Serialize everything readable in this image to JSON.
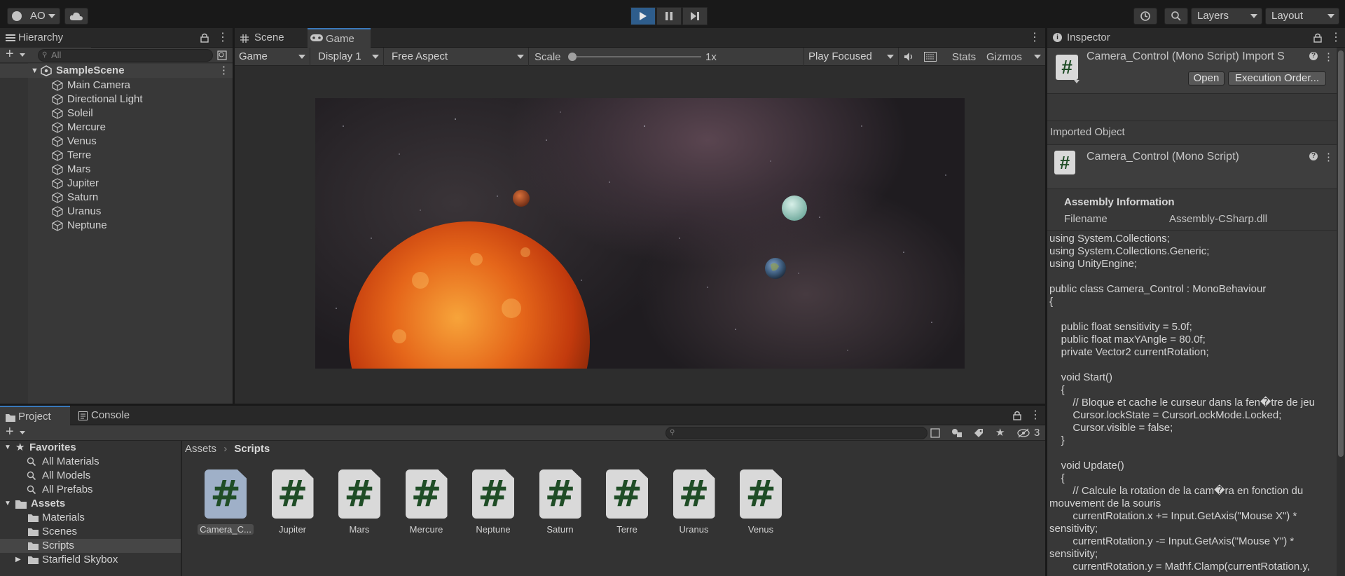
{
  "toolbar": {
    "account": "AO",
    "layers": "Layers",
    "layout": "Layout"
  },
  "hierarchy": {
    "tab": "Hierarchy",
    "search_placeholder": "All",
    "scene": "SampleScene",
    "items": [
      "Main Camera",
      "Directional Light",
      "Soleil",
      "Mercure",
      "Venus",
      "Terre",
      "Mars",
      "Jupiter",
      "Saturn",
      "Uranus",
      "Neptune"
    ]
  },
  "game_view": {
    "tabs": [
      "Scene",
      "Game"
    ],
    "mode": "Game",
    "display": "Display 1",
    "aspect": "Free Aspect",
    "scale_label": "Scale",
    "scale_value": "1x",
    "play_mode": "Play Focused",
    "stats": "Stats",
    "gizmos": "Gizmos"
  },
  "inspector": {
    "tab": "Inspector",
    "title": "Camera_Control (Mono Script) Import S",
    "open_button": "Open",
    "exec_button": "Execution Order...",
    "imported_object": "Imported Object",
    "object_title": "Camera_Control (Mono Script)",
    "assembly_header": "Assembly Information",
    "filename_label": "Filename",
    "filename_value": "Assembly-CSharp.dll",
    "code": "using System.Collections;\nusing System.Collections.Generic;\nusing UnityEngine;\n\npublic class Camera_Control : MonoBehaviour\n{\n\n    public float sensitivity = 5.0f;\n    public float maxYAngle = 80.0f;\n    private Vector2 currentRotation;\n\n    void Start()\n    {\n        // Bloque et cache le curseur dans la fen�tre de jeu\n        Cursor.lockState = CursorLockMode.Locked;\n        Cursor.visible = false;\n    }\n\n    void Update()\n    {\n        // Calcule la rotation de la cam�ra en fonction du mouvement de la souris\n        currentRotation.x += Input.GetAxis(\"Mouse X\") * sensitivity;\n        currentRotation.y -= Input.GetAxis(\"Mouse Y\") * sensitivity;\n        currentRotation.y = Mathf.Clamp(currentRotation.y,"
  },
  "project": {
    "tabs": [
      "Project",
      "Console"
    ],
    "hidden_count": "3",
    "favorites_label": "Favorites",
    "favorites": [
      "All Materials",
      "All Models",
      "All Prefabs"
    ],
    "assets_label": "Assets",
    "folders": [
      "Materials",
      "Scenes",
      "Scripts",
      "Starfield Skybox"
    ],
    "breadcrumb_root": "Assets",
    "breadcrumb_current": "Scripts",
    "files": [
      "Camera_C...",
      "Jupiter",
      "Mars",
      "Mercure",
      "Neptune",
      "Saturn",
      "Terre",
      "Uranus",
      "Venus"
    ]
  }
}
